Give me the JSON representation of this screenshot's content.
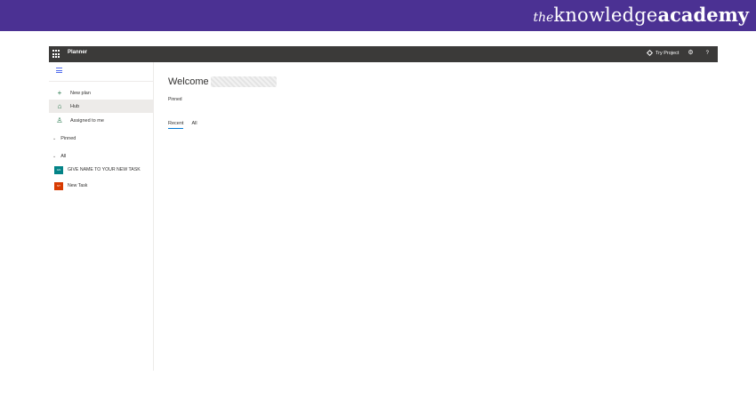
{
  "brand": {
    "prefix": "the",
    "name": "knowledge",
    "suffix": "academy"
  },
  "app": {
    "title": "Planner",
    "topbar": {
      "try_label": "Try Project",
      "settings_icon": "gear-icon",
      "help_label": "?"
    }
  },
  "sidebar": {
    "nav": [
      {
        "label": "New plan",
        "icon": "plus-icon"
      },
      {
        "label": "Hub",
        "icon": "home-icon"
      },
      {
        "label": "Assigned to me",
        "icon": "person-icon"
      }
    ],
    "sections": {
      "pinned": "Pinned",
      "all": "All"
    },
    "plans": [
      {
        "label": "GIVE NAME TO YOUR NEW TASK",
        "badge": "GN",
        "color": "#038387"
      },
      {
        "label": "New Task",
        "badge": "NT",
        "color": "#d83b01"
      }
    ]
  },
  "main": {
    "welcome": "Welcome",
    "pinned_label": "Pinned",
    "tabs": [
      "Recent",
      "All"
    ]
  },
  "colors": {
    "banner": "#4b3193",
    "topbar": "#3b3a39",
    "accent": "#0078d4",
    "selected": "#edebe9"
  }
}
